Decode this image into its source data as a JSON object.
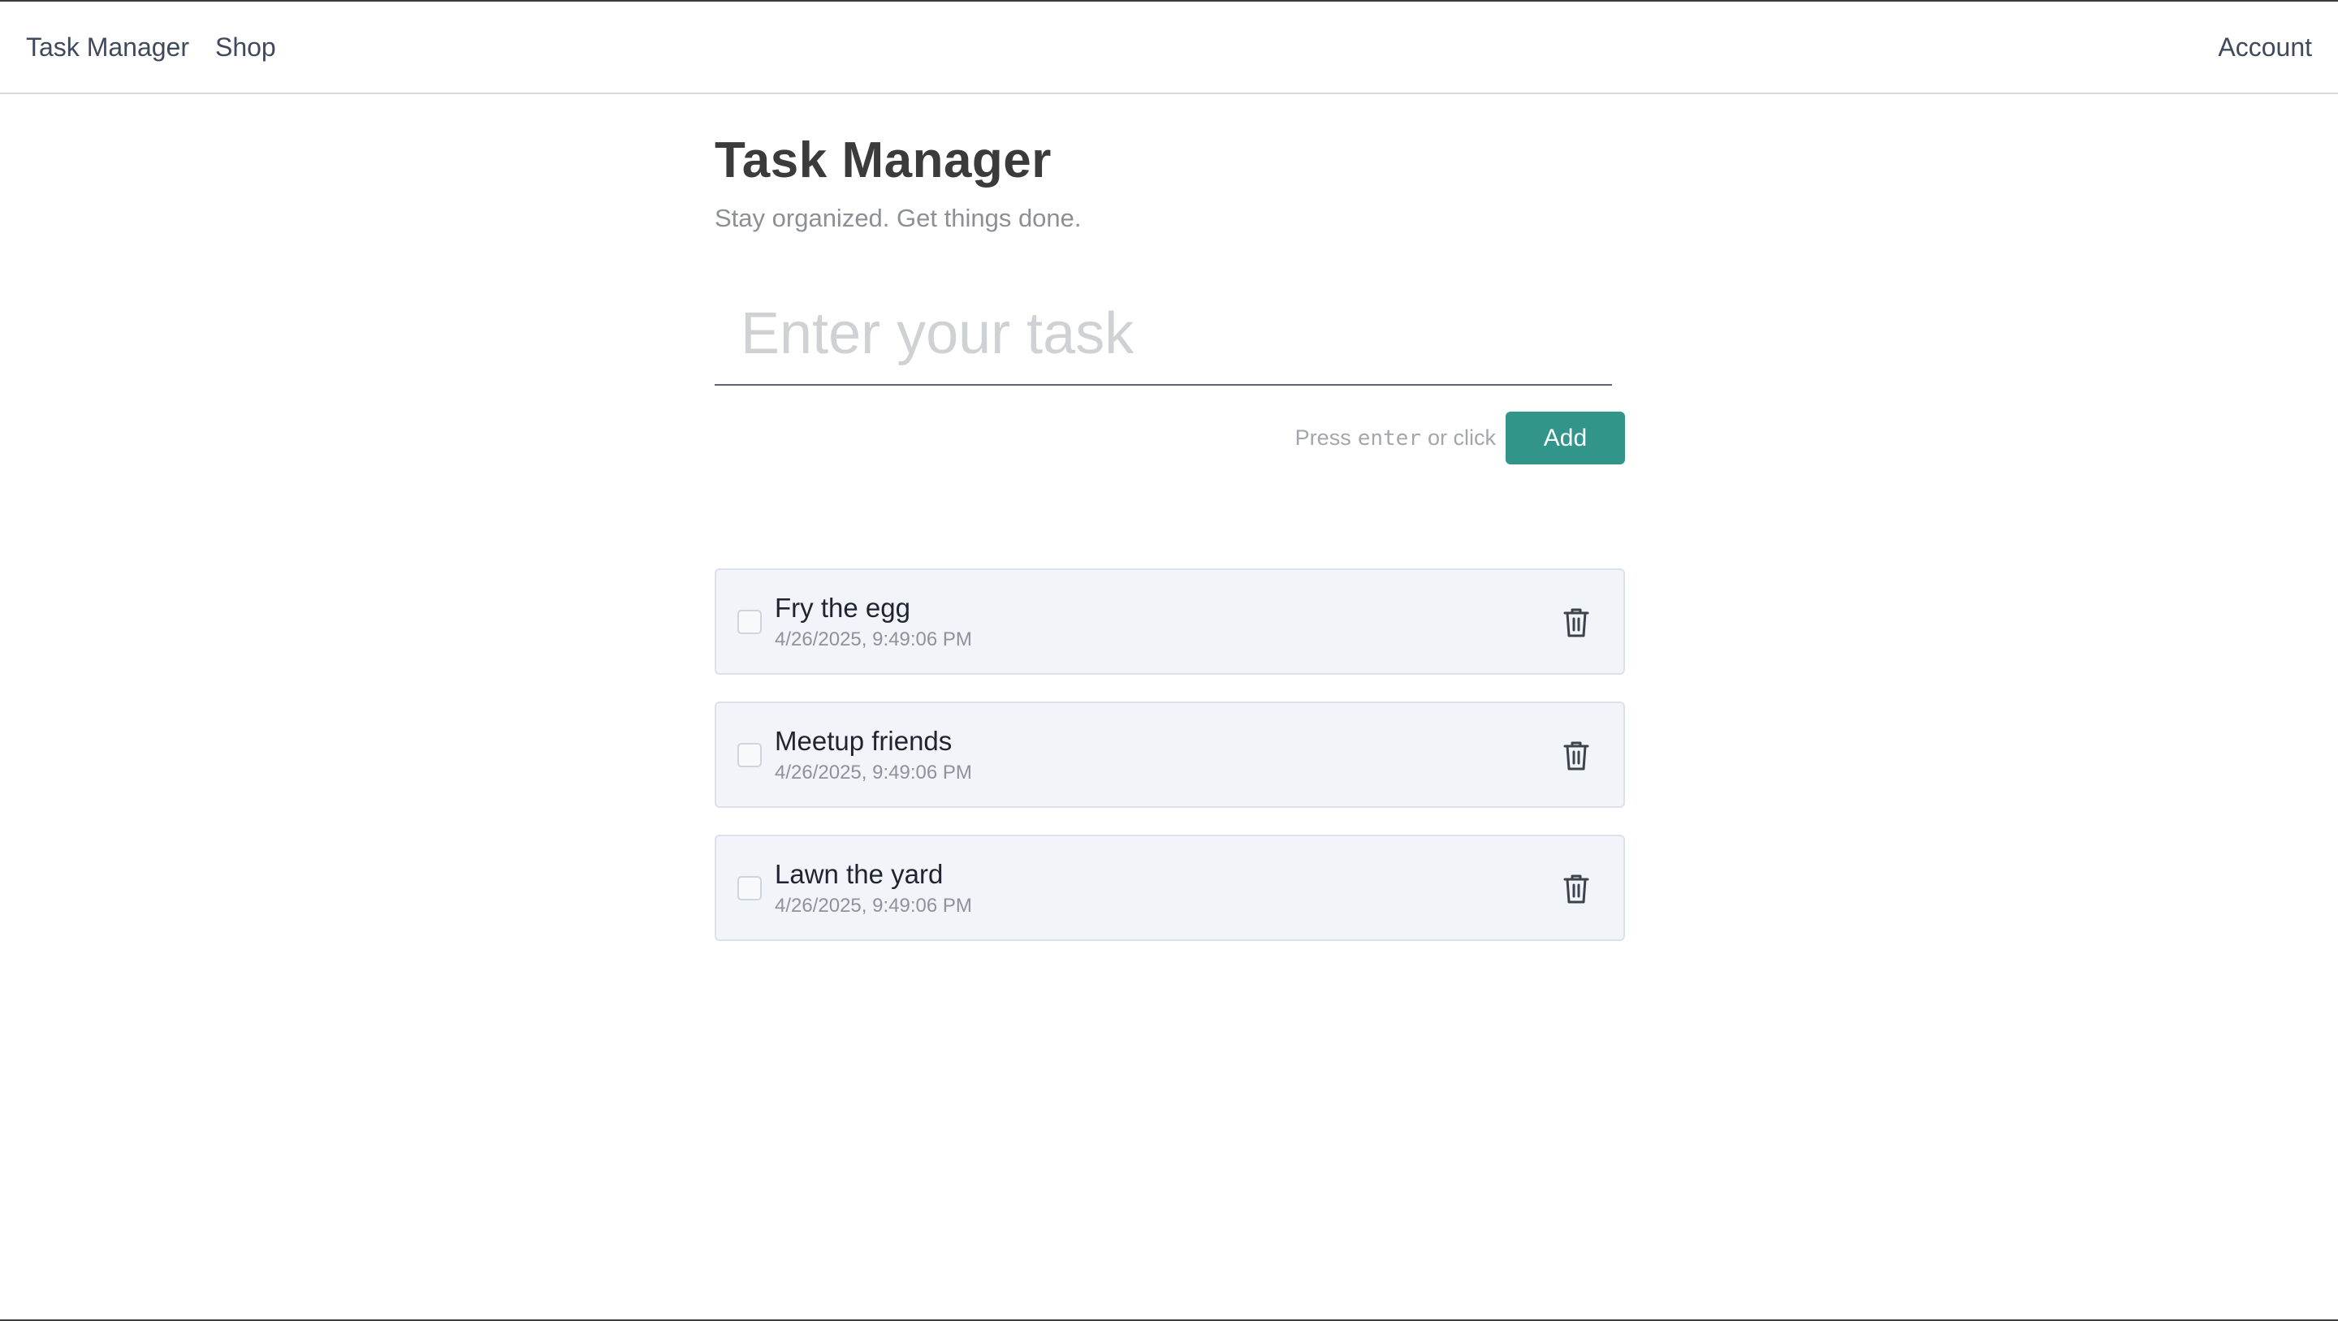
{
  "nav": {
    "left_links": [
      {
        "label": "Task Manager"
      },
      {
        "label": "Shop"
      }
    ],
    "right_link": "Account"
  },
  "header": {
    "title": "Task Manager",
    "subtitle": "Stay organized. Get things done."
  },
  "input": {
    "placeholder": "Enter your task",
    "value": ""
  },
  "add": {
    "hint_prefix": "Press",
    "hint_key": "enter",
    "hint_suffix": "or click",
    "button_label": "Add",
    "button_color": "#32958a"
  },
  "tasks": [
    {
      "title": "Fry the egg",
      "date": "4/26/2025, 9:49:06 PM",
      "checked": false
    },
    {
      "title": "Meetup friends",
      "date": "4/26/2025, 9:49:06 PM",
      "checked": false
    },
    {
      "title": "Lawn the yard",
      "date": "4/26/2025, 9:49:06 PM",
      "checked": false
    }
  ],
  "icons": {
    "delete": "trash-icon"
  }
}
